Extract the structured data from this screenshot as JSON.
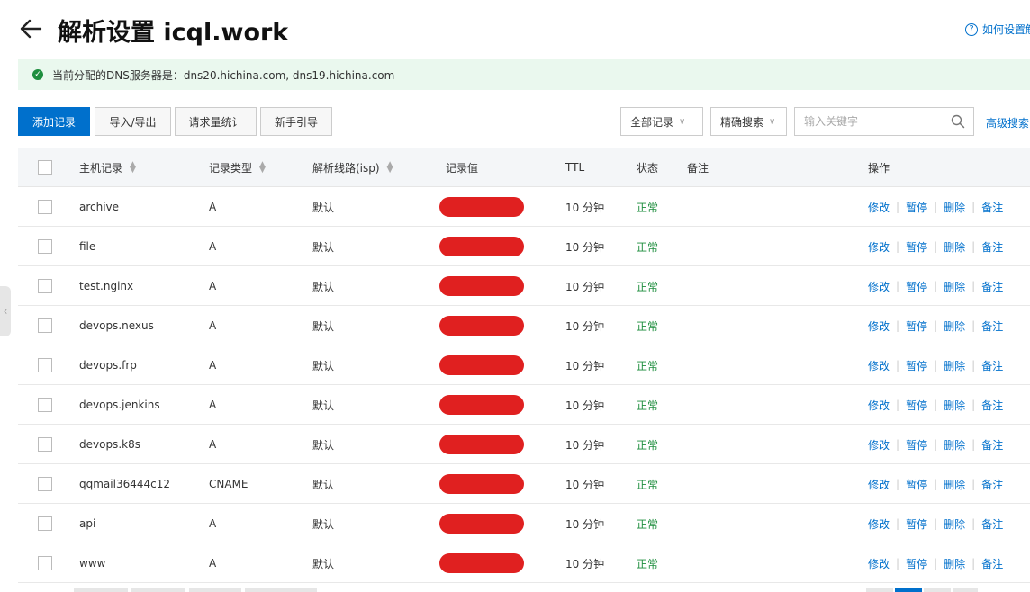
{
  "header": {
    "title": "解析设置 icql.work",
    "help_link": "如何设置解"
  },
  "notice": {
    "text": "当前分配的DNS服务器是：dns20.hichina.com, dns19.hichina.com"
  },
  "toolbar": {
    "add_record": "添加记录",
    "import_export": "导入/导出",
    "request_stats": "请求量统计",
    "beginner_guide": "新手引导",
    "filter_all": "全部记录",
    "exact_search": "精确搜索",
    "search_placeholder": "输入关键字",
    "advanced_search": "高级搜索"
  },
  "table": {
    "columns": {
      "host": "主机记录",
      "type": "记录类型",
      "line": "解析线路(isp)",
      "value": "记录值",
      "ttl": "TTL",
      "status": "状态",
      "remark": "备注",
      "ops": "操作"
    },
    "actions": {
      "edit": "修改",
      "pause": "暂停",
      "delete": "删除",
      "remark": "备注"
    },
    "rows": [
      {
        "host": "archive",
        "type": "A",
        "line": "默认",
        "ttl": "10 分钟",
        "status": "正常"
      },
      {
        "host": "file",
        "type": "A",
        "line": "默认",
        "ttl": "10 分钟",
        "status": "正常"
      },
      {
        "host": "test.nginx",
        "type": "A",
        "line": "默认",
        "ttl": "10 分钟",
        "status": "正常"
      },
      {
        "host": "devops.nexus",
        "type": "A",
        "line": "默认",
        "ttl": "10 分钟",
        "status": "正常"
      },
      {
        "host": "devops.frp",
        "type": "A",
        "line": "默认",
        "ttl": "10 分钟",
        "status": "正常"
      },
      {
        "host": "devops.jenkins",
        "type": "A",
        "line": "默认",
        "ttl": "10 分钟",
        "status": "正常"
      },
      {
        "host": "devops.k8s",
        "type": "A",
        "line": "默认",
        "ttl": "10 分钟",
        "status": "正常"
      },
      {
        "host": "qqmail36444c12",
        "type": "CNAME",
        "line": "默认",
        "ttl": "10 分钟",
        "status": "正常"
      },
      {
        "host": "api",
        "type": "A",
        "line": "默认",
        "ttl": "10 分钟",
        "status": "正常"
      },
      {
        "host": "www",
        "type": "A",
        "line": "默认",
        "ttl": "10 分钟",
        "status": "正常"
      }
    ]
  },
  "colors": {
    "accent": "#0070cc",
    "status_ok": "#1e8e3e",
    "notice_bg": "#eaf8ee",
    "redaction": "#e02020"
  }
}
